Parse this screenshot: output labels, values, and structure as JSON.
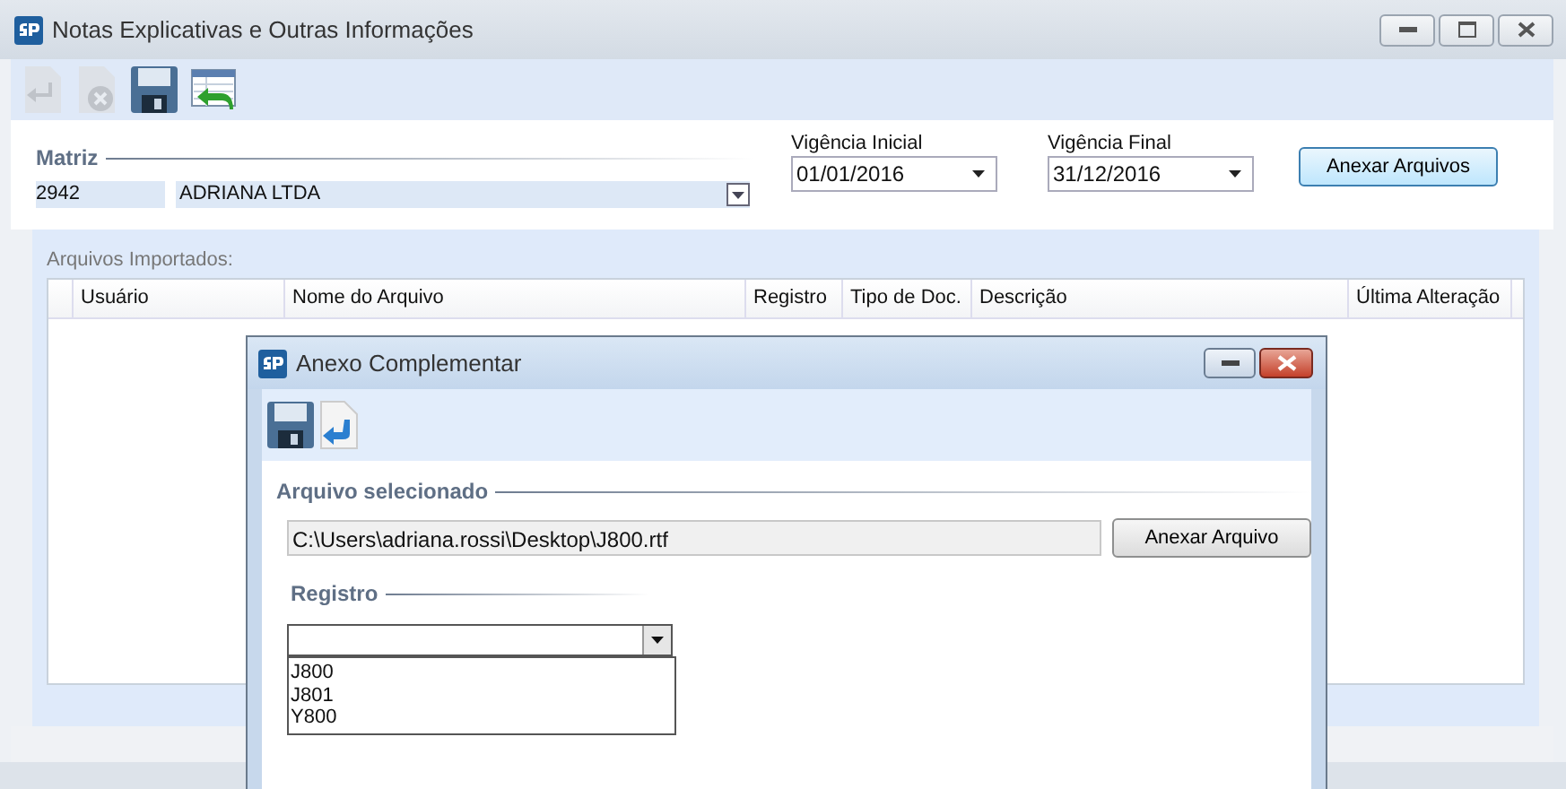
{
  "window": {
    "title": "Notas Explicativas e Outras Informações"
  },
  "toolbar": [
    {
      "disabled": true
    },
    {
      "disabled": true
    },
    {
      "disabled": false
    },
    {
      "disabled": false
    }
  ],
  "matriz": {
    "label": "Matriz",
    "code": "2942",
    "name": "ADRIANA LTDA"
  },
  "vigencia_inicial": {
    "label": "Vigência Inicial",
    "value": "01/01/2016"
  },
  "vigencia_final": {
    "label": "Vigência Final",
    "value": "31/12/2016"
  },
  "attach_files_button": "Anexar Arquivos",
  "imported": {
    "label": "Arquivos Importados:",
    "columns": [
      "Usuário",
      "Nome do Arquivo",
      "Registro",
      "Tipo de Doc.",
      "Descrição",
      "Última Alteração"
    ]
  },
  "dialog": {
    "title": "Anexo Complementar",
    "toolbar": [
      {
        "disabled": false
      },
      {
        "disabled": false
      }
    ],
    "section": "Arquivo selecionado",
    "file_path": "C:\\Users\\adriana.rossi\\Desktop\\J800.rtf",
    "attach_button": "Anexar Arquivo",
    "registro": {
      "label": "Registro",
      "expanded": true,
      "options": [
        "J800",
        "J801",
        "Y800"
      ]
    }
  }
}
